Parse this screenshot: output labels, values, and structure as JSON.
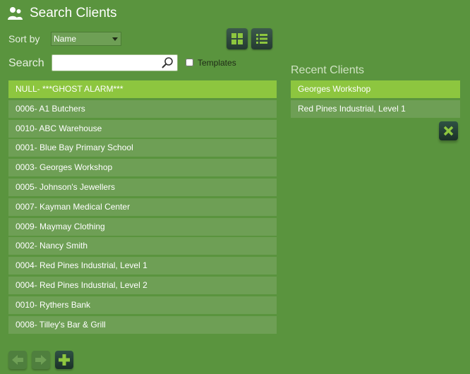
{
  "header": {
    "title": "Search Clients",
    "icon": "users-icon"
  },
  "toolbar": {
    "sort_label": "Sort by",
    "sort_value": "Name",
    "grid_view_icon": "grid-view-icon",
    "list_view_icon": "list-view-icon"
  },
  "search": {
    "label": "Search",
    "value": "",
    "placeholder": "",
    "templates_label": "Templates",
    "templates_checked": false
  },
  "clients": [
    "NULL- ***GHOST ALARM***",
    "0006- A1 Butchers",
    "0010- ABC Warehouse",
    "0001- Blue Bay Primary School",
    "0003- Georges Workshop",
    "0005- Johnson's Jewellers",
    "0007- Kayman Medical Center",
    "0009- Maymay Clothing",
    "0002- Nancy Smith",
    "0004- Red Pines Industrial, Level 1",
    "0004- Red Pines Industrial, Level 2",
    "0010- Rythers Bank",
    "0008- Tilley's Bar & Grill"
  ],
  "recent": {
    "title": "Recent Clients",
    "items": [
      "Georges Workshop",
      "Red Pines Industrial, Level 1"
    ],
    "clear_icon": "close-icon"
  },
  "footer": {
    "prev_icon": "arrow-left-icon",
    "next_icon": "arrow-right-icon",
    "add_icon": "plus-icon"
  },
  "colors": {
    "background": "#5a943e",
    "row": "#6e9f55",
    "selected_row": "#8dc63f",
    "button_dark": "#243a31"
  }
}
